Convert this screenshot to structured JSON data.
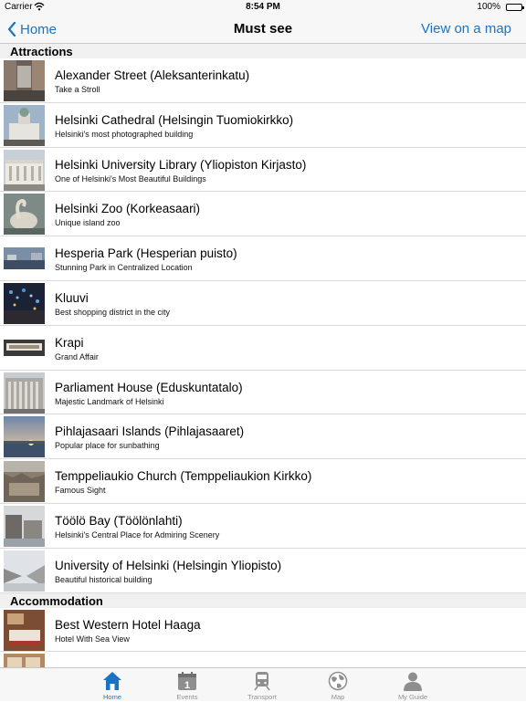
{
  "status_bar": {
    "carrier": "Carrier",
    "time": "8:54 PM",
    "battery": "100%",
    "battery_level": 1.0
  },
  "nav": {
    "back_label": "Home",
    "title": "Must see",
    "right_action": "View on a map",
    "accent_color": "#1a73c6"
  },
  "sections": [
    {
      "header": "Attractions",
      "items": [
        {
          "title": "Alexander Street (Aleksanterinkatu)",
          "subtitle": "Take a Stroll"
        },
        {
          "title": "Helsinki Cathedral (Helsingin Tuomiokirkko)",
          "subtitle": "Helsinki's most photographed building"
        },
        {
          "title": "Helsinki University Library (Yliopiston Kirjasto)",
          "subtitle": "One of Helsinki's Most Beautiful Buildings"
        },
        {
          "title": "Helsinki Zoo (Korkeasaari)",
          "subtitle": "Unique island zoo"
        },
        {
          "title": "Hesperia Park (Hesperian puisto)",
          "subtitle": "Stunning Park in Centralized Location"
        },
        {
          "title": "Kluuvi",
          "subtitle": "Best shopping district in the city"
        },
        {
          "title": "Krapi",
          "subtitle": "Grand Affair"
        },
        {
          "title": "Parliament House (Eduskuntatalo)",
          "subtitle": "Majestic Landmark of Helsinki"
        },
        {
          "title": "Pihlajasaari Islands (Pihlajasaaret)",
          "subtitle": "Popular place for sunbathing"
        },
        {
          "title": "Temppeliaukio Church (Temppeliaukion Kirkko)",
          "subtitle": "Famous Sight"
        },
        {
          "title": "Töölö Bay (Töölönlahti)",
          "subtitle": "Helsinki's Central Place for Admiring Scenery"
        },
        {
          "title": "University of Helsinki (Helsingin Yliopisto)",
          "subtitle": "Beautiful historical building"
        }
      ]
    },
    {
      "header": "Accommodation",
      "items": [
        {
          "title": "Best Western Hotel Haaga",
          "subtitle": "Hotel With Sea View"
        }
      ]
    }
  ],
  "tabs": [
    {
      "label": "Home",
      "icon": "house-icon",
      "active": true
    },
    {
      "label": "Events",
      "icon": "calendar-icon",
      "calendar_day": "1",
      "active": false
    },
    {
      "label": "Transport",
      "icon": "train-icon",
      "active": false
    },
    {
      "label": "Map",
      "icon": "globe-icon",
      "active": false
    },
    {
      "label": "My Guide",
      "icon": "person-icon",
      "active": false
    }
  ]
}
